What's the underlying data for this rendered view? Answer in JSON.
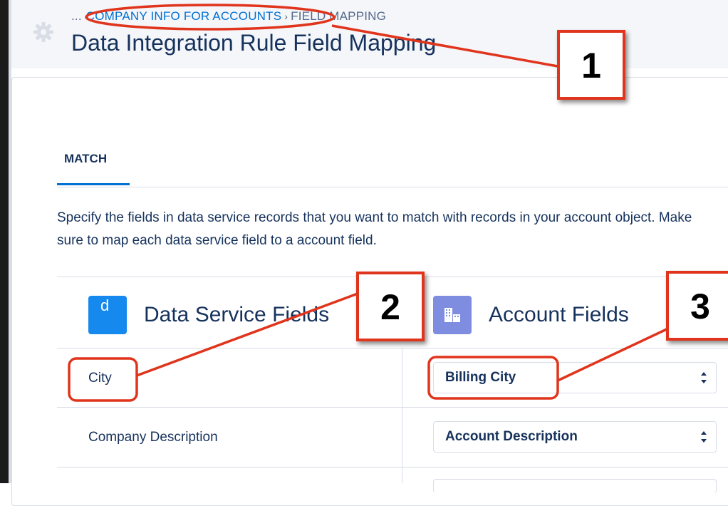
{
  "header": {
    "breadcrumb": {
      "ellipsis": "...",
      "parent": "COMPANY INFO FOR ACCOUNTS",
      "separator": "›",
      "current": "FIELD MAPPING"
    },
    "title": "Data Integration Rule Field Mapping"
  },
  "tabs": [
    {
      "label": "MATCH",
      "active": true
    }
  ],
  "description": "Specify the fields in data service records that you want to match with records in your account object. Make sure to map each data service field to a account field.",
  "columns": {
    "data_service": {
      "label": "Data Service Fields",
      "icon_letter": "d"
    },
    "account": {
      "label": "Account Fields"
    }
  },
  "rows": [
    {
      "field": "City",
      "mapped": "Billing City"
    },
    {
      "field": "Company Description",
      "mapped": "Account Description"
    }
  ],
  "callouts": [
    "1",
    "2",
    "3"
  ],
  "colors": {
    "accent": "#0070d2",
    "annotation": "#e0341c",
    "data_service_badge": "#1589ee",
    "account_badge": "#7f8de1"
  }
}
